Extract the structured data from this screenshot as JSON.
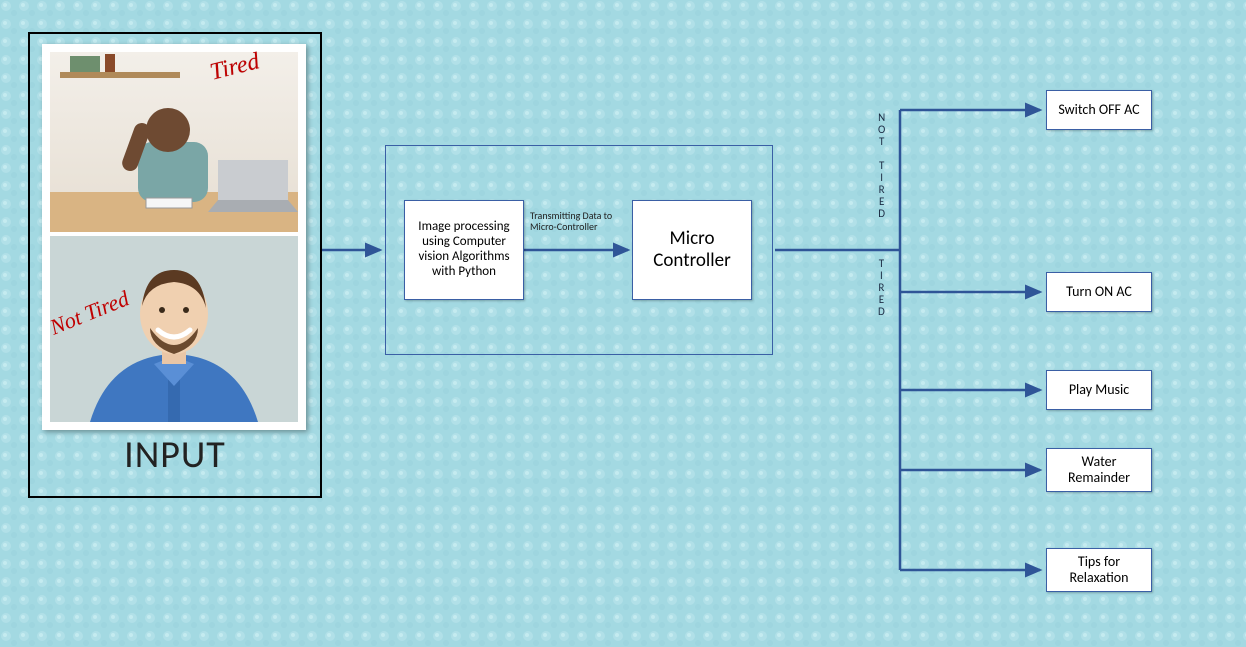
{
  "input_section": {
    "label": "INPUT",
    "photo_label_tired": "Tired",
    "photo_label_not_tired": "Not Tired"
  },
  "processing_box_label": "Image processing using Computer vision Algorithms with Python",
  "transmit_label": "Transmitting Data to Micro-Controller",
  "controller_label": "Micro Controller",
  "branch_labels": {
    "not_tired": "NOT TIRED",
    "tired": "TIRED"
  },
  "outputs": {
    "switch_off_ac": "Switch OFF AC",
    "turn_on_ac": "Turn ON AC",
    "play_music": "Play  Music",
    "water_remainder": "Water Remainder",
    "tips_relax": "Tips for Relaxation"
  },
  "colors": {
    "background": "#a3d9e2",
    "box_border": "#3a5fa5",
    "arrow": "#2f5597",
    "overlay_text": "#c00000",
    "input_border": "#000000"
  }
}
